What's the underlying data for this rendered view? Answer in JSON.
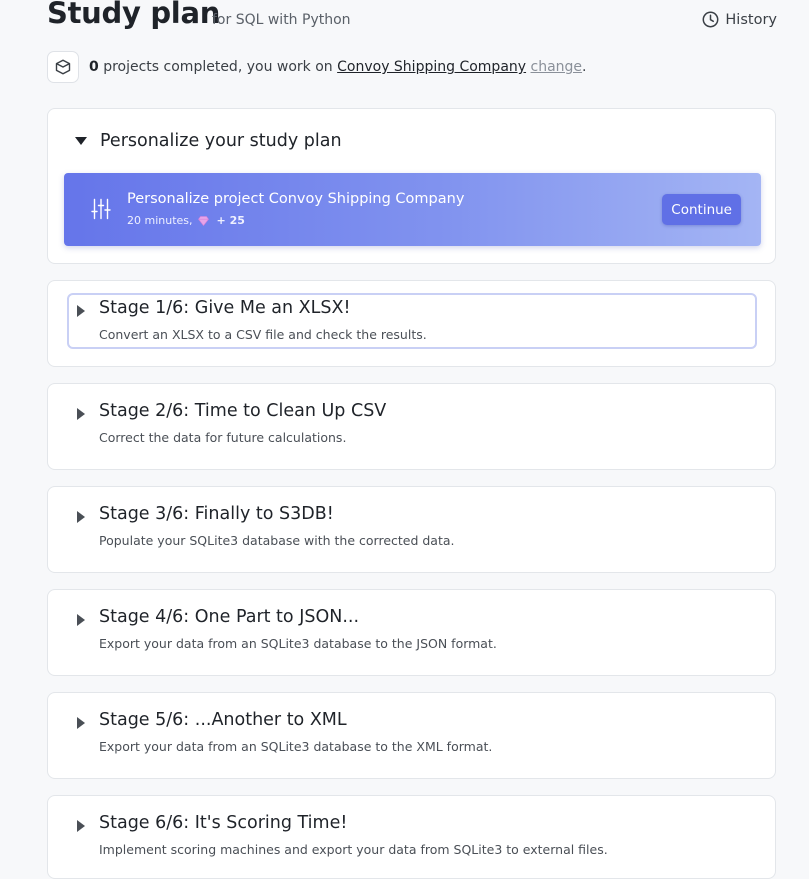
{
  "header": {
    "title": "Study plan",
    "subtitle": "for SQL with Python",
    "history_label": "History"
  },
  "status": {
    "completed_count": "0",
    "text_before_project": "projects completed, you work on",
    "project_name": "Convoy Shipping Company",
    "change_label": "change",
    "trailing": "."
  },
  "personalize": {
    "heading": "Personalize your study plan",
    "banner_title": "Personalize project Convoy Shipping Company",
    "duration": "20 minutes,",
    "points": "+ 25",
    "continue_label": "Continue",
    "gem_color": "#e7a4e8",
    "accent_color": "#6070e6"
  },
  "stages": [
    {
      "title": "Stage 1/6: Give Me an XLSX!",
      "desc": "Convert an XLSX to a CSV file and check the results."
    },
    {
      "title": "Stage 2/6: Time to Clean Up CSV",
      "desc": "Correct the data for future calculations."
    },
    {
      "title": "Stage 3/6: Finally to S3DB!",
      "desc": "Populate your SQLite3 database with the corrected data."
    },
    {
      "title": "Stage 4/6: One Part to JSON...",
      "desc": "Export your data from an SQLite3 database to the JSON format."
    },
    {
      "title": "Stage 5/6: ...Another to XML",
      "desc": "Export your data from an SQLite3 database to the XML format."
    },
    {
      "title": "Stage 6/6: It's Scoring Time!",
      "desc": "Implement scoring machines and export your data from SQLite3 to external files."
    }
  ]
}
